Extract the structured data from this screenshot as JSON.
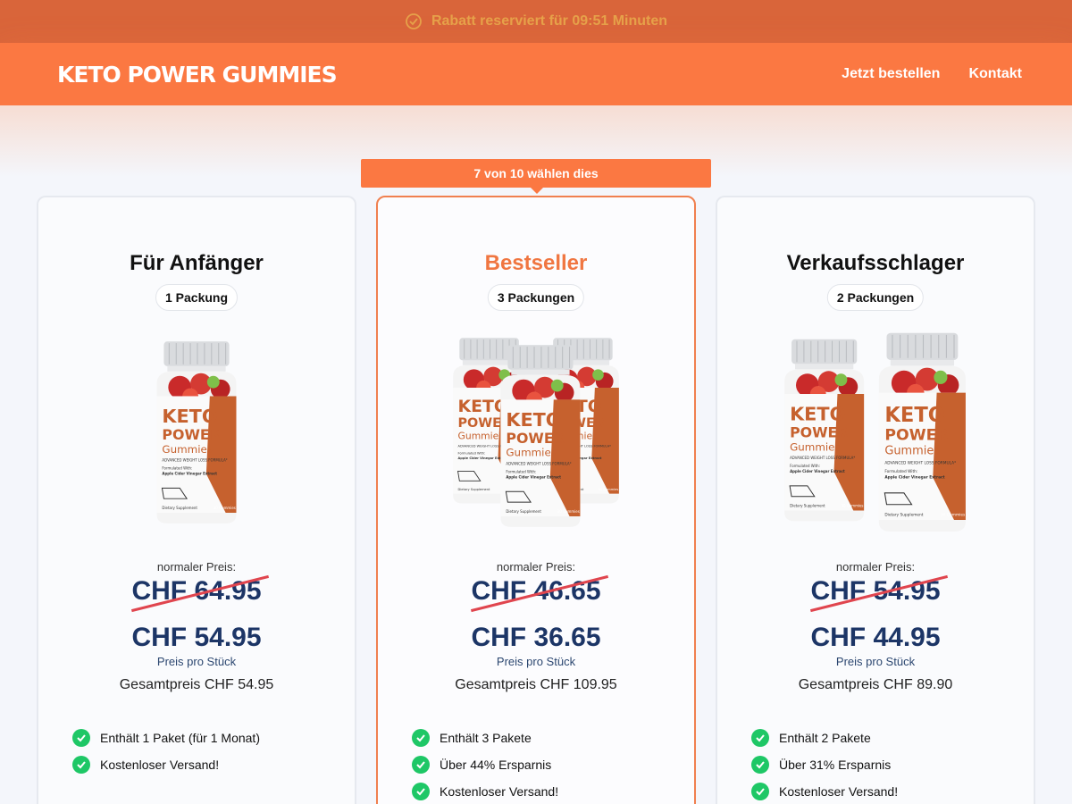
{
  "topbar": {
    "text": "Rabatt reserviert für 09:51 Minuten",
    "icon": "timer-check-icon"
  },
  "header": {
    "logo": "KETO POWER GUMMIES",
    "nav": [
      {
        "label": "Jetzt bestellen"
      },
      {
        "label": "Kontakt"
      }
    ]
  },
  "highlight_badge": "7 von 10 wählen dies",
  "colors": {
    "accent": "#fb7842",
    "topbar": "#d9653a",
    "price": "#1c3566",
    "check": "#1ec766",
    "strike": "#e0454e"
  },
  "cards": [
    {
      "title": "Für Anfänger",
      "packages": "1 Packung",
      "regular_label": "normaler Preis:",
      "old_price": "CHF 64.95",
      "new_price": "CHF 54.95",
      "per_piece": "Preis pro Stück",
      "total": "Gesamtpreis CHF 54.95",
      "features": [
        "Enthält 1 Paket (für 1 Monat)",
        "Kostenloser Versand!"
      ]
    },
    {
      "title": "Bestseller",
      "packages": "3 Packungen",
      "regular_label": "normaler Preis:",
      "old_price": "CHF 46.65",
      "new_price": "CHF 36.65",
      "per_piece": "Preis pro Stück",
      "total": "Gesamtpreis CHF 109.95",
      "features": [
        "Enthält 3 Pakete",
        "Über 44% Ersparnis",
        "Kostenloser Versand!"
      ]
    },
    {
      "title": "Verkaufsschlager",
      "packages": "2 Packungen",
      "regular_label": "normaler Preis:",
      "old_price": "CHF 54.95",
      "new_price": "CHF 44.95",
      "per_piece": "Preis pro Stück",
      "total": "Gesamtpreis CHF 89.90",
      "features": [
        "Enthält 2 Pakete",
        "Über 31% Ersparnis",
        "Kostenloser Versand!"
      ]
    }
  ],
  "bottle_label": {
    "line1": "KETO",
    "line2": "POWER",
    "line3": "Gummies",
    "tagline": "ADVANCED WEIGHT LOSS FORMULA*",
    "formulated": "Formulated With:",
    "ingredient": "Apple Cider Vinegar Extract",
    "footer_left": "Dietary Supplement",
    "footer_right": "30 Gummies"
  }
}
